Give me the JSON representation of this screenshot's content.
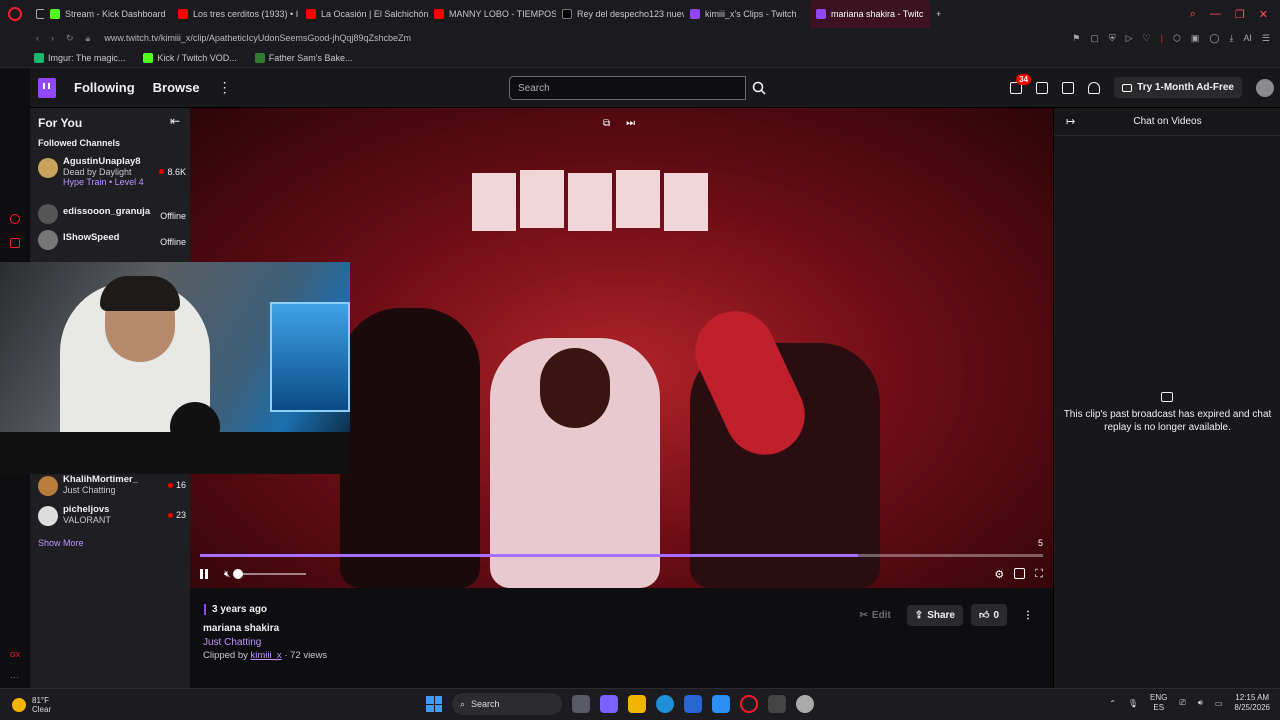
{
  "browser": {
    "tabs": [
      {
        "label": "Stream - Kick Dashboard",
        "color": "#53fc18"
      },
      {
        "label": "Los tres cerditos (1933) • I",
        "color": "#ff0000"
      },
      {
        "label": "La Ocasión | El Salchichón",
        "color": "#ff0000"
      },
      {
        "label": "MANNY LOBO - TIEMPOS",
        "color": "#ff0000"
      },
      {
        "label": "Rey del despecho123 nuev",
        "color": "#000000"
      },
      {
        "label": "kimiii_x's Clips - Twitch",
        "color": "#9147ff"
      },
      {
        "label": "mariana shakira - Twitc",
        "color": "#9147ff"
      }
    ],
    "new_tab_symbol": "+",
    "url": "www.twitch.tv/kimiii_x/clip/ApatheticIcyUdonSeemsGood-jhQqj89qZshcbeZm",
    "bookmarks": [
      {
        "label": "Imgur: The magic...",
        "color": "#1bb76e"
      },
      {
        "label": "Kick / Twitch VOD...",
        "color": "#53fc18"
      },
      {
        "label": "Father Sam's Bake...",
        "color": "#2e7d32"
      }
    ],
    "ai_label": "AI"
  },
  "nav": {
    "following": "Following",
    "browse": "Browse",
    "more": "⋮",
    "search_placeholder": "Search",
    "notif_count": "34",
    "adfree": "Try 1-Month Ad-Free"
  },
  "sidebar": {
    "heading": "For You",
    "subheading": "Followed Channels",
    "channels": [
      {
        "name": "AgustinUnaplay8",
        "game": "Dead by Daylight",
        "extra": "Hype Train • Level 4",
        "stat": "8.6K",
        "live": true,
        "color": "#caa35a"
      },
      {
        "name": "edissooon_granuja",
        "game": "",
        "extra": "",
        "stat": "Offline",
        "live": false,
        "color": "#555"
      },
      {
        "name": "IShowSpeed",
        "game": "",
        "extra": "",
        "stat": "Offline",
        "live": false,
        "color": "#777"
      },
      {
        "name": "KhalihMortimer_",
        "game": "Just Chatting",
        "extra": "",
        "stat": "16",
        "live": true,
        "color": "#b87d3a"
      },
      {
        "name": "picheljovs",
        "game": "VALORANT",
        "extra": "",
        "stat": "23",
        "live": true,
        "color": "#ddd"
      }
    ],
    "show_more": "Show More"
  },
  "player": {
    "progress": 0.78,
    "volume": 0.0,
    "corner_count": "5"
  },
  "clip": {
    "ago": "3 years ago",
    "title": "mariana shakira",
    "category": "Just Chatting",
    "clipped_by_prefix": "Clipped by",
    "clipper": "kimiii_x",
    "views": "· 72 views",
    "edit": "Edit",
    "share": "Share",
    "likes": "0"
  },
  "chat": {
    "title": "Chat on Videos",
    "message": "This clip's past broadcast has expired and chat replay is no longer available."
  },
  "taskbar": {
    "temp": "81°F",
    "weather": "Clear",
    "search": "Search",
    "lang1": "ENG",
    "lang2": "ES",
    "time": "12:15 AM",
    "date": "8/25/2026"
  }
}
